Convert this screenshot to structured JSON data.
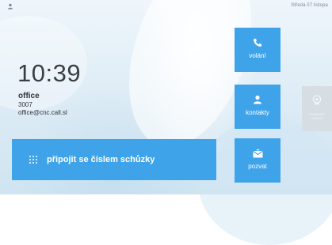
{
  "status": {
    "date": "Středa 07 listopa"
  },
  "home": {
    "time": "10:39",
    "user_name": "office",
    "extension": "3007",
    "email": "office@cnc.call.sl"
  },
  "actions": {
    "join_meeting_label": "připojit se číslem schůzky",
    "call_label": "volání",
    "contacts_label": "kontakty",
    "invite_label": "pozvat",
    "camera_settings_label": "nastavení kamery"
  },
  "colors": {
    "accent": "#3fa3ea",
    "disabled_tile": "#d6dde3"
  }
}
